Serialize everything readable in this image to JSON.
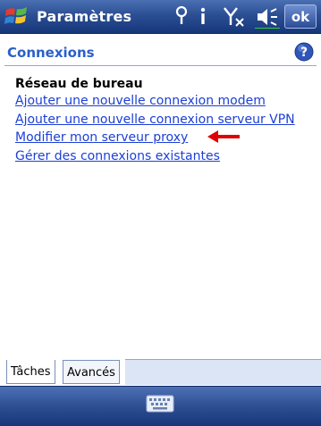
{
  "titlebar": {
    "app_title": "Paramètres",
    "ok_label": "ok",
    "icons": [
      "windows-start-icon",
      "connectivity-icon",
      "info-icon",
      "no-signal-icon",
      "volume-icon"
    ]
  },
  "header": {
    "title": "Connexions",
    "help_icon": "help-icon"
  },
  "content": {
    "section_title": "Réseau de bureau",
    "links": [
      "Ajouter une nouvelle connexion modem",
      "Ajouter une nouvelle connexion serveur VPN",
      "Modifier mon serveur proxy",
      "Gérer des connexions existantes"
    ],
    "annotation_arrow_color": "#e00000"
  },
  "tabs": [
    {
      "label": "Tâches",
      "active": true
    },
    {
      "label": "Avancés",
      "active": false
    }
  ],
  "bottombar": {
    "icon": "keyboard-icon"
  },
  "colors": {
    "title_bar": "#2c4f93",
    "header_text": "#2b5fc9",
    "link": "#1c3fd6"
  }
}
